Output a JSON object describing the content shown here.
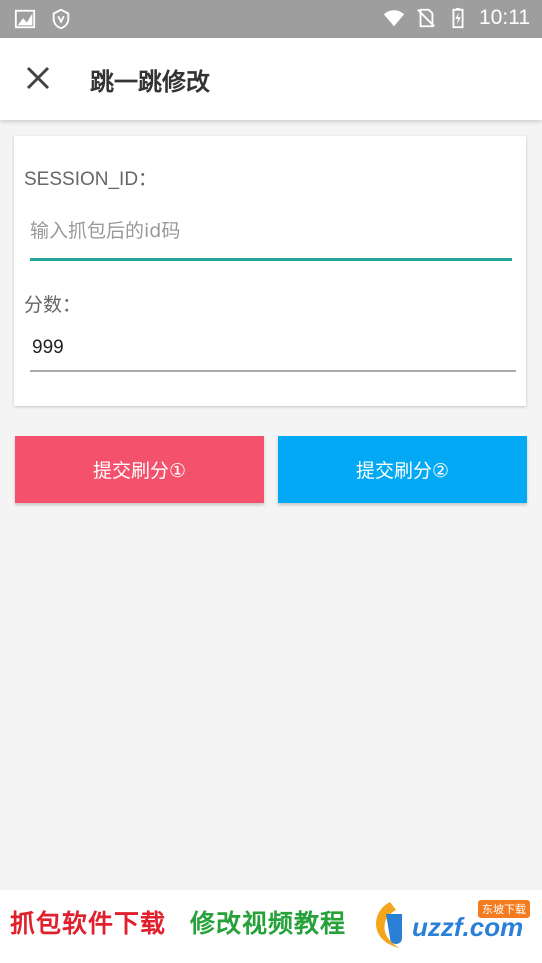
{
  "status_bar": {
    "time": "10:11",
    "icons": [
      "image-icon",
      "shield-icon",
      "wifi-icon",
      "no-sim-icon",
      "battery-charging-icon"
    ]
  },
  "app_bar": {
    "title": "跳一跳修改",
    "close_icon": "close-icon"
  },
  "form": {
    "session_label": "SESSION_ID：",
    "session_placeholder": "输入抓包后的id码",
    "session_value": "",
    "score_label": "分数：",
    "score_value": "999"
  },
  "buttons": {
    "submit1": "提交刷分①",
    "submit2": "提交刷分②"
  },
  "footer": {
    "link1": "抓包软件下载",
    "link2": "修改视频教程",
    "logo_text": "uzzf.com",
    "logo_badge": "东坡下载"
  },
  "colors": {
    "accent_teal": "#26a69a",
    "button_red": "#f4516c",
    "button_blue": "#03a9f4"
  }
}
